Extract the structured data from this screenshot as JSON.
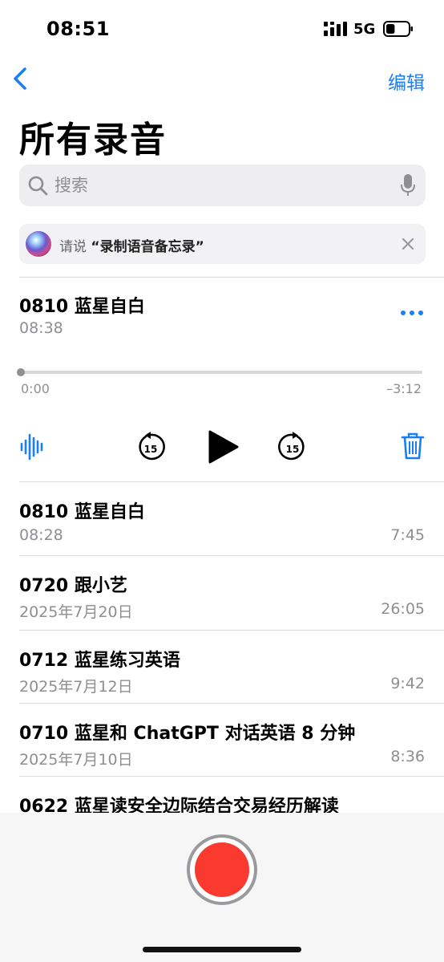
{
  "status_bar": {
    "time": "08:51",
    "network": "5G",
    "battery_level": 0.4
  },
  "nav": {
    "back_icon": "chevron-left-icon",
    "edit_label": "编辑"
  },
  "page_title": "所有录音",
  "search": {
    "placeholder": "搜索",
    "value": ""
  },
  "siri_tip": {
    "prefix": "请说",
    "phrase": "“录制语音备忘录”"
  },
  "expanded": {
    "title": "0810 蓝星自白",
    "date": "08:38",
    "elapsed": "0:00",
    "remaining": "–3:12",
    "progress": 0.0,
    "skip_seconds": "15"
  },
  "recordings": [
    {
      "title": "0810 蓝星自白",
      "date": "08:28",
      "duration": "7:45"
    },
    {
      "title": "0720 跟小艺",
      "date": "2025年7月20日",
      "duration": "26:05"
    },
    {
      "title": "0712 蓝星练习英语",
      "date": "2025年7月12日",
      "duration": "9:42"
    },
    {
      "title": "0710 蓝星和 ChatGPT 对话英语 8 分钟",
      "date": "2025年7月10日",
      "duration": "8:36"
    },
    {
      "title": "0622 蓝星读安全边际结合交易经历解读",
      "date": "",
      "duration": ""
    }
  ],
  "colors": {
    "accent": "#1a7ff5",
    "record": "#fa3a2f"
  }
}
